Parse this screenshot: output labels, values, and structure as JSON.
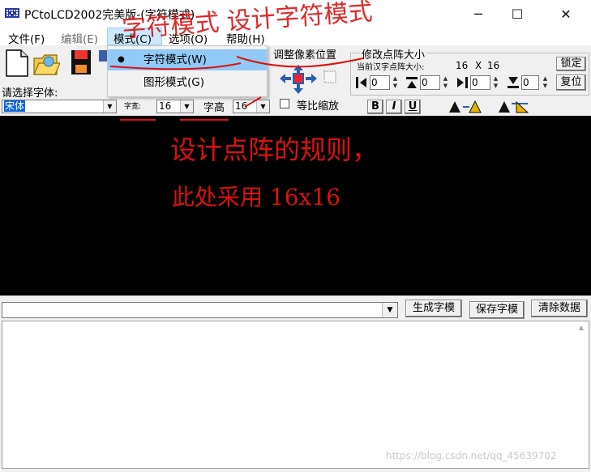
{
  "window": {
    "title": "PCtoLCD2002完美版-(字符模式)",
    "minimize_glyph": "─",
    "maximize_glyph": "☐",
    "close_glyph": "✕"
  },
  "menu": {
    "file": "文件(F)",
    "edit": "编辑(E)",
    "mode": "模式(C)",
    "options": "选项(O)",
    "help": "帮助(H)"
  },
  "mode_menu": {
    "items": [
      {
        "label": "字符模式(W)",
        "checked": true
      },
      {
        "label": "图形模式(G)",
        "checked": false
      }
    ],
    "check_glyph": "●"
  },
  "toolbar": {
    "adjust_pixel_label": "调整像素位置",
    "modify_size_label": "修改点阵大小",
    "current_size_label": "当前汉字点阵大小:",
    "current_width": "16",
    "current_x": "X",
    "current_height": "16",
    "lock_button": "锁定",
    "reset_button": "复位",
    "spin_values": [
      "0",
      "0",
      "0",
      "0"
    ],
    "select_font_label": "请选择字体:",
    "font_value": "宋体",
    "char_width_label": "字宽:",
    "char_width_value": "16",
    "char_height_label": "字高",
    "char_height_value": "16",
    "proportional_label": "等比缩放",
    "proportional_checked": false,
    "bold_label": "B",
    "italic_label": "I",
    "underline_label": "U"
  },
  "annotations": {
    "top": "字符模式 设计字符模式",
    "line1": "设计点阵的规则，",
    "line2": "此处采用 16x16"
  },
  "bottom": {
    "generate_button": "生成字模",
    "save_button": "保存字模",
    "clear_button": "清除数据",
    "output_value": ""
  },
  "watermark": "https://blog.csdn.net/qq_45639702",
  "colors": {
    "canvas": "#000000",
    "menu_highlight": "#cce8ff",
    "annotation": "#dd1111"
  }
}
